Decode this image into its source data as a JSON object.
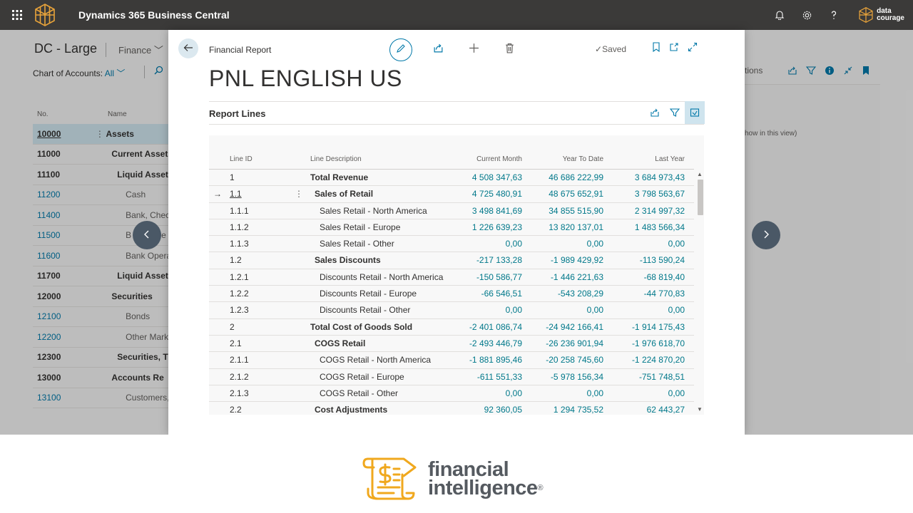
{
  "topbar": {
    "app_title": "Dynamics 365 Business Central",
    "company_logo_text": "data\ncourage",
    "company_logo_line1": "data",
    "company_logo_line2": "courage"
  },
  "background": {
    "page_title": "DC - Large",
    "menu_label": "Finance",
    "filter_label": "Chart of Accounts:",
    "filter_value": "All",
    "columns": {
      "no": "No.",
      "name": "Name"
    },
    "right_label": "tions",
    "right_note": "how in this view)",
    "rows": [
      {
        "no": "10000",
        "name": "Assets",
        "style": "b",
        "selected": true
      },
      {
        "no": "11000",
        "name": "Current Asset",
        "style": "b"
      },
      {
        "no": "11100",
        "name": "Liquid Asset",
        "style": "b"
      },
      {
        "no": "11200",
        "name": "Cash",
        "style": "l"
      },
      {
        "no": "11400",
        "name": "Bank, Chec",
        "style": "l"
      },
      {
        "no": "11500",
        "name": "B",
        "name_tail": "re",
        "style": "l"
      },
      {
        "no": "11600",
        "name": "Bank Opera",
        "style": "l"
      },
      {
        "no": "11700",
        "name": "Liquid Asset",
        "style": "b"
      },
      {
        "no": "12000",
        "name": "Securities",
        "style": "b"
      },
      {
        "no": "12100",
        "name": "Bonds",
        "style": "l"
      },
      {
        "no": "12200",
        "name": "Other Mark",
        "style": "l"
      },
      {
        "no": "12300",
        "name": "Securities, T",
        "style": "b"
      },
      {
        "no": "13000",
        "name": "Accounts Re",
        "style": "b"
      },
      {
        "no": "13100",
        "name": "Customers,",
        "style": "l"
      }
    ]
  },
  "dialog": {
    "breadcrumb": "Financial Report",
    "saved_label": "Saved",
    "title": "PNL ENGLISH US",
    "section_title": "Report Lines",
    "columns": {
      "line_id": "Line ID",
      "line_description": "Line Description",
      "current_month": "Current Month",
      "year_to_date": "Year To Date",
      "last_year": "Last Year"
    },
    "rows": [
      {
        "id": "1",
        "desc": "Total Revenue",
        "cm": "4 508 347,63",
        "ytd": "46 686 222,99",
        "ly": "3 684 973,43",
        "bold": true,
        "indent": 0
      },
      {
        "id": "1.1",
        "desc": "Sales of Retail",
        "cm": "4 725 480,91",
        "ytd": "48 675 652,91",
        "ly": "3 798 563,67",
        "bold": true,
        "indent": 1,
        "current": true
      },
      {
        "id": "1.1.1",
        "desc": "Sales  Retail - North America",
        "cm": "3 498 841,69",
        "ytd": "34 855 515,90",
        "ly": "2 314 997,32",
        "indent": 2
      },
      {
        "id": "1.1.2",
        "desc": "Sales  Retail - Europe",
        "cm": "1 226 639,23",
        "ytd": "13 820 137,01",
        "ly": "1 483 566,34",
        "indent": 2
      },
      {
        "id": "1.1.3",
        "desc": "Sales  Retail - Other",
        "cm": "0,00",
        "ytd": "0,00",
        "ly": "0,00",
        "indent": 2
      },
      {
        "id": "1.2",
        "desc": "Sales Discounts",
        "cm": "-217 133,28",
        "ytd": "-1 989 429,92",
        "ly": "-113 590,24",
        "bold": true,
        "indent": 1
      },
      {
        "id": "1.2.1",
        "desc": "Discounts  Retail - North America",
        "cm": "-150 586,77",
        "ytd": "-1 446 221,63",
        "ly": "-68 819,40",
        "indent": 2
      },
      {
        "id": "1.2.2",
        "desc": "Discounts  Retail - Europe",
        "cm": "-66 546,51",
        "ytd": "-543 208,29",
        "ly": "-44 770,83",
        "indent": 2
      },
      {
        "id": "1.2.3",
        "desc": "Discounts  Retail - Other",
        "cm": "0,00",
        "ytd": "0,00",
        "ly": "0,00",
        "indent": 2
      },
      {
        "id": "2",
        "desc": "Total Cost of Goods Sold",
        "cm": "-2 401 086,74",
        "ytd": "-24 942 166,41",
        "ly": "-1 914 175,43",
        "bold": true,
        "indent": 0
      },
      {
        "id": "2.1",
        "desc": "COGS  Retail",
        "cm": "-2 493 446,79",
        "ytd": "-26 236 901,94",
        "ly": "-1 976 618,70",
        "bold": true,
        "indent": 1
      },
      {
        "id": "2.1.1",
        "desc": "COGS  Retail - North America",
        "cm": "-1 881 895,46",
        "ytd": "-20 258 745,60",
        "ly": "-1 224 870,20",
        "indent": 2
      },
      {
        "id": "2.1.2",
        "desc": "COGS  Retail - Europe",
        "cm": "-611 551,33",
        "ytd": "-5 978 156,34",
        "ly": "-751 748,51",
        "indent": 2
      },
      {
        "id": "2.1.3",
        "desc": "COGS  Retail - Other",
        "cm": "0,00",
        "ytd": "0,00",
        "ly": "0,00",
        "indent": 2
      },
      {
        "id": "2.2",
        "desc": "Cost Adjustments",
        "cm": "92 360,05",
        "ytd": "1 294 735,52",
        "ly": "62 443,27",
        "bold": true,
        "indent": 1
      }
    ]
  },
  "brand": {
    "line1": "financial",
    "line2": "intelligence",
    "registered": "®"
  },
  "colors": {
    "accent": "#0078a8",
    "number": "#00788a",
    "topbar": "#3b3a39",
    "brand_gold": "#f0a81e",
    "brand_text": "#555a60"
  }
}
